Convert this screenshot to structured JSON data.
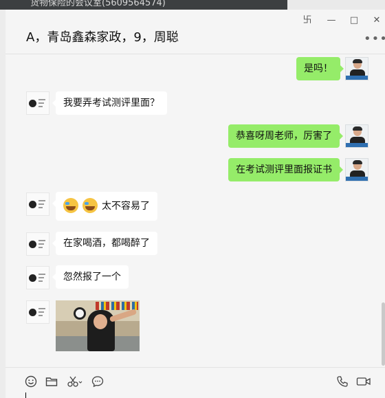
{
  "window": {
    "top_title_cut": "货物保险的会议室(5609564574)",
    "pin_icon": "pin-icon",
    "minimize_icon": "minimize-icon",
    "maximize_icon": "maximize-icon",
    "close_icon": "close-icon"
  },
  "header": {
    "title": "A，青岛鑫森家政，9，周聪",
    "more_icon": "more-icon"
  },
  "messages": [
    {
      "side": "out",
      "text": "是吗！"
    },
    {
      "side": "in",
      "text": "我要弄考试测评里面？"
    },
    {
      "side": "out",
      "text": "恭喜呀周老师，厉害了"
    },
    {
      "side": "out",
      "text": "在考试测评里面报证书"
    },
    {
      "side": "in",
      "text": "太不容易了",
      "emojis": [
        "crying-laughing-emoji",
        "crying-laughing-emoji"
      ]
    },
    {
      "side": "in",
      "text": "在家喝酒，都喝醉了"
    },
    {
      "side": "in",
      "text": "忽然报了一个"
    },
    {
      "side": "in",
      "type": "image",
      "image": "photo-message"
    }
  ],
  "toolbar": {
    "icons": [
      "emoji-icon",
      "folder-icon",
      "screenshot-scissors-icon",
      "chat-history-icon",
      "voice-call-icon",
      "video-call-icon"
    ]
  },
  "colors": {
    "outgoing_bubble": "#95ec69",
    "incoming_bubble": "#ffffff",
    "background": "#f5f5f5"
  }
}
